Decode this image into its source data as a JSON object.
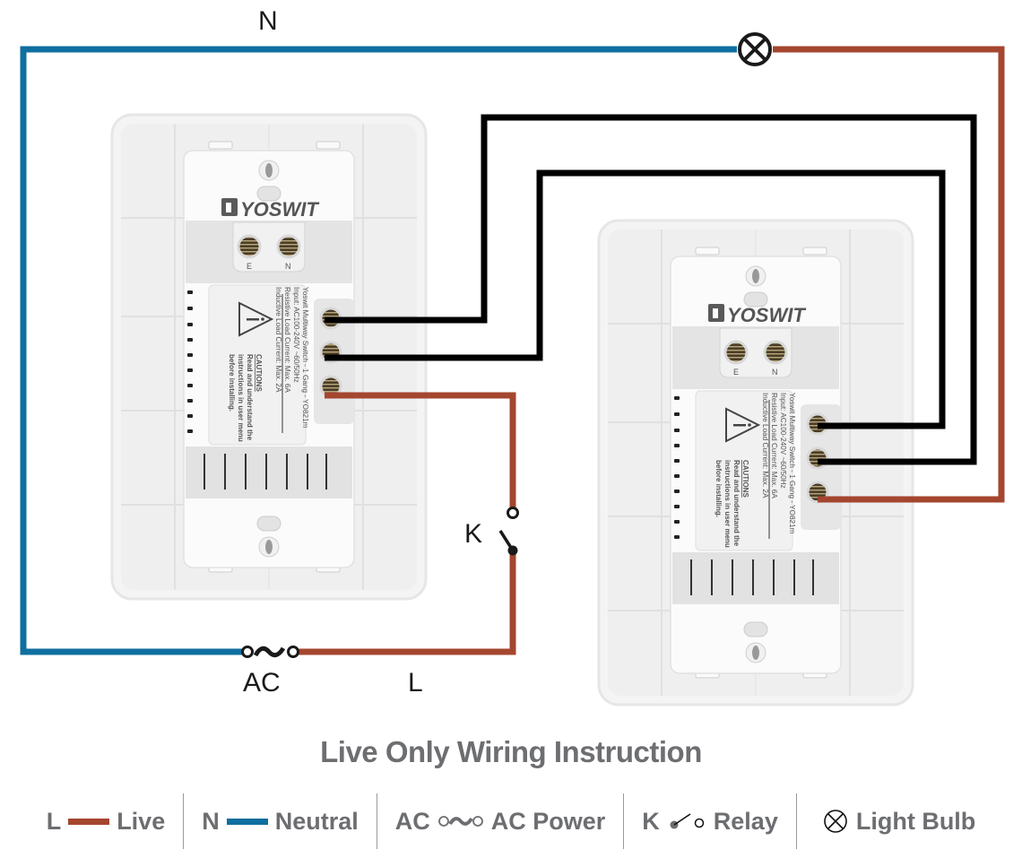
{
  "diagram": {
    "title": "Live Only Wiring Instruction",
    "wire_labels": {
      "neutral": "N",
      "live": "L",
      "ac_source": "AC",
      "relay": "K"
    },
    "colors": {
      "live": "#a5462f",
      "neutral": "#0f6fa0",
      "traveler": "#000000",
      "text": "#6d6e71"
    },
    "switches": [
      {
        "id": "switch-1",
        "brand": "YOSWIT",
        "top_terminals": [
          "E",
          "N"
        ],
        "label_lines": [
          "Yoswit Multiway Switch - 1 Gang - YO821m",
          "Input: AC100-240V ~60/50Hz",
          "Resistive Load Current: Max. 6A",
          "Inductive Load Current: Max. 2A"
        ],
        "caution_title": "CAUTIONS",
        "caution_lines": [
          "Read and understand the",
          "instructions in user menu",
          "before installing."
        ]
      },
      {
        "id": "switch-2",
        "brand": "YOSWIT",
        "top_terminals": [
          "E",
          "N"
        ],
        "label_lines": [
          "Yoswit Multiway Switch - 1 Gang - YO821m",
          "Input: AC100-240V ~60/50Hz",
          "Resistive Load Current: Max. 6A",
          "Inductive Load Current: Max. 2A"
        ],
        "caution_title": "CAUTIONS",
        "caution_lines": [
          "Read and understand the",
          "instructions in user menu",
          "before installing."
        ]
      }
    ]
  },
  "legend": [
    {
      "symbol": "L",
      "icon": "live-wire-icon",
      "label": "Live"
    },
    {
      "symbol": "N",
      "icon": "neutral-wire-icon",
      "label": "Neutral"
    },
    {
      "symbol": "AC",
      "icon": "ac-power-icon",
      "label": "AC Power"
    },
    {
      "symbol": "K",
      "icon": "relay-icon",
      "label": "Relay"
    },
    {
      "symbol": "",
      "icon": "light-bulb-icon",
      "label": "Light Bulb"
    }
  ]
}
